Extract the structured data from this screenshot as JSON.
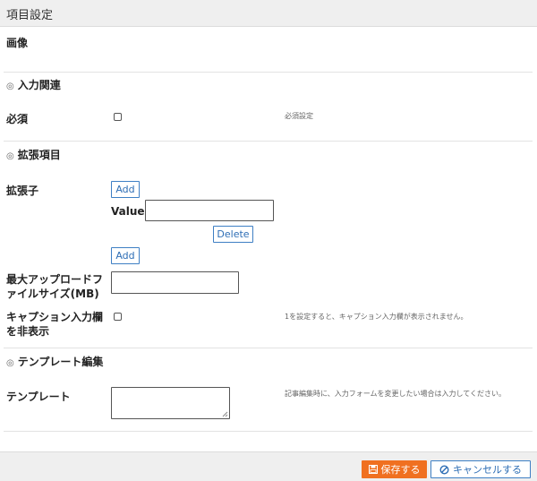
{
  "dialog": {
    "title": "項目設定"
  },
  "fields": {
    "image_label": "画像",
    "required_label": "必須",
    "required_help": "必須設定",
    "extension_label": "拡張子",
    "add_label": "Add",
    "value_label": "Value",
    "value_text": "",
    "delete_label": "Delete",
    "max_upload_label": "最大アップロードファイルサイズ(MB)",
    "max_upload_value": "",
    "hide_caption_label": "キャプション入力欄を非表示",
    "hide_caption_help": "1を設定すると、キャプション入力欄が表示されません。",
    "template_label": "テンプレート",
    "template_value": "",
    "template_help": "記事編集時に、入力フォームを変更したい場合は入力してください。"
  },
  "sections": {
    "input": "入力関連",
    "extension": "拡張項目",
    "template": "テンプレート編集"
  },
  "footer": {
    "save_label": "保存する",
    "cancel_label": "キャンセルする"
  },
  "icons": {
    "section_marker": "◎",
    "save": "floppy-disk-icon",
    "cancel": "ban-icon"
  },
  "colors": {
    "save_button": "#f07020",
    "link_blue": "#2e6eb5"
  }
}
